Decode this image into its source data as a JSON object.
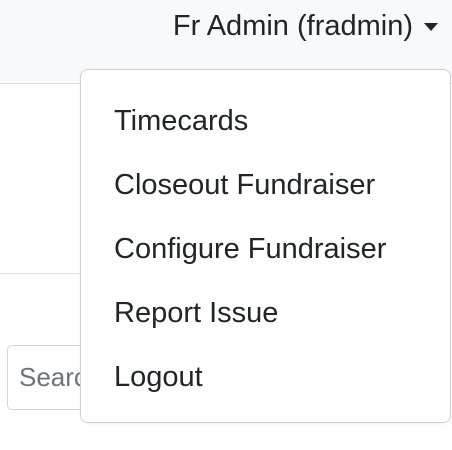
{
  "navbar": {
    "user_label": "Fr Admin (fradmin)"
  },
  "search": {
    "placeholder": "Search"
  },
  "user_menu": {
    "items": [
      {
        "label": "Timecards"
      },
      {
        "label": "Closeout Fundraiser"
      },
      {
        "label": "Configure Fundraiser"
      },
      {
        "label": "Report Issue"
      },
      {
        "label": "Logout"
      }
    ]
  },
  "colors": {
    "navbar_background": "#f8f9fa",
    "text": "#212529",
    "border": "#dee2e6"
  },
  "icons": {
    "user_toggle": "caret-down-icon"
  }
}
